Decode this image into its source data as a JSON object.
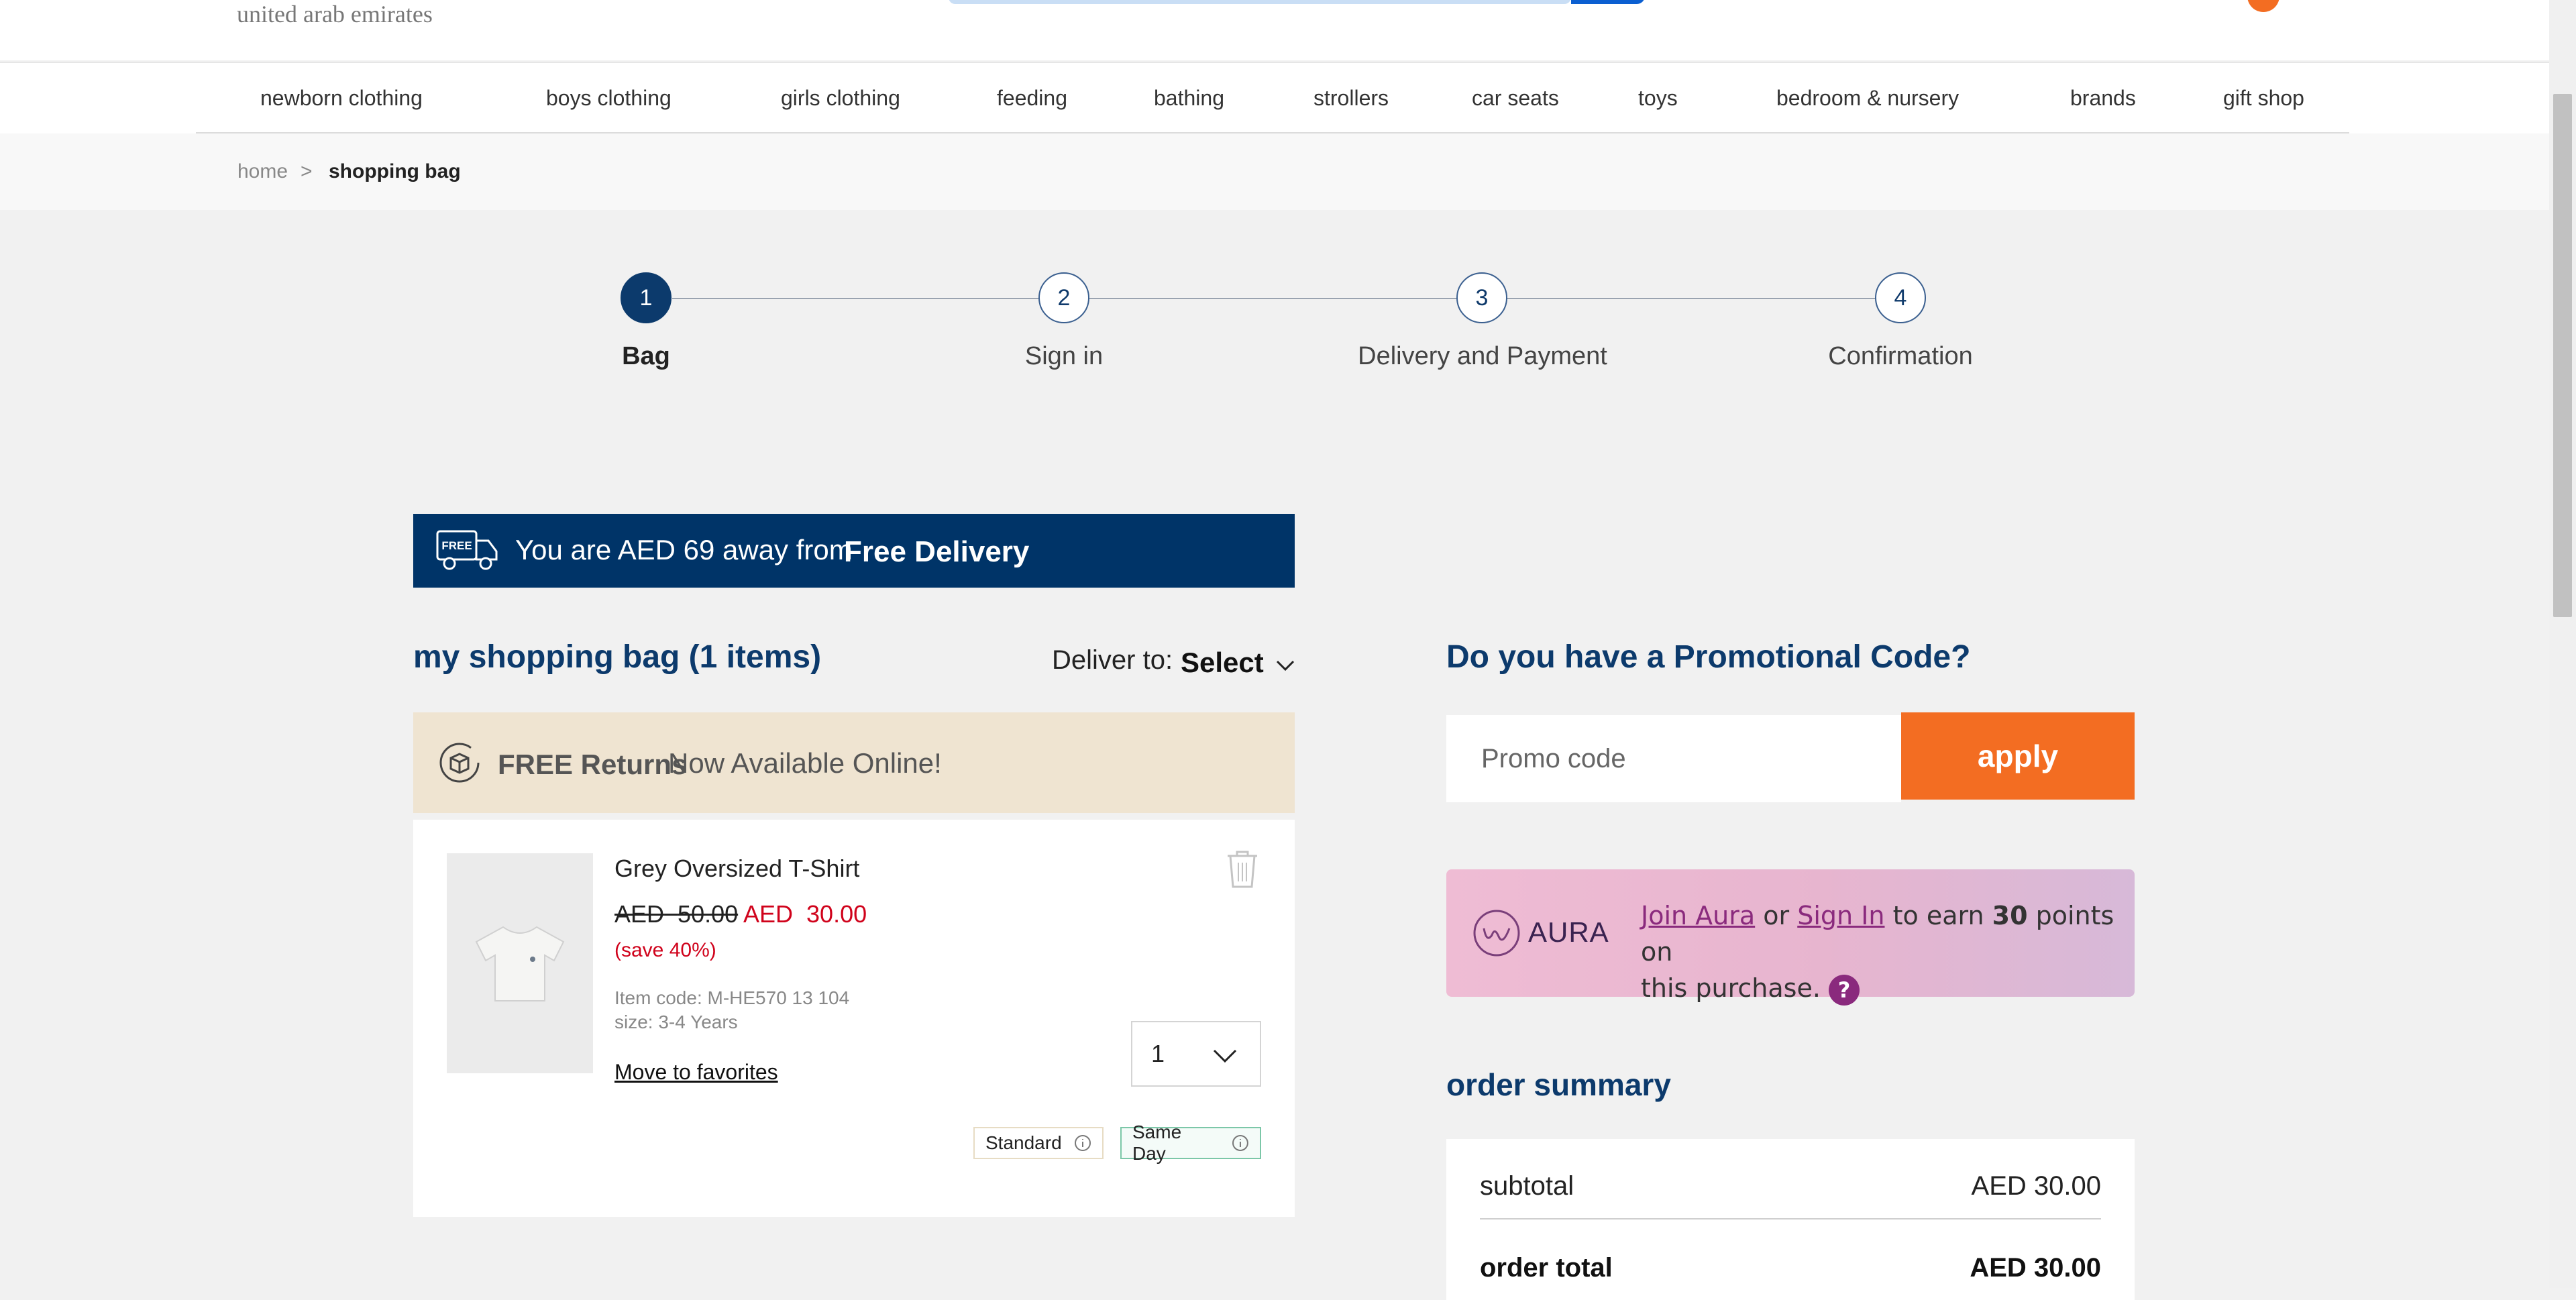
{
  "header": {
    "location": "united arab emirates"
  },
  "nav": {
    "items": [
      "newborn clothing",
      "boys clothing",
      "girls clothing",
      "feeding",
      "bathing",
      "strollers",
      "car seats",
      "toys",
      "bedroom & nursery",
      "brands",
      "gift shop"
    ]
  },
  "breadcrumb": {
    "home": "home",
    "separator": ">",
    "current": "shopping bag"
  },
  "stepper": {
    "steps": [
      {
        "number": "1",
        "label": "Bag"
      },
      {
        "number": "2",
        "label": "Sign in"
      },
      {
        "number": "3",
        "label": "Delivery and Payment"
      },
      {
        "number": "4",
        "label": "Confirmation"
      }
    ],
    "active_step": 1
  },
  "free_delivery": {
    "icon_text": "FREE",
    "prefix": "You are AED 69 away from",
    "highlight": "Free Delivery"
  },
  "bag": {
    "title": "my shopping bag (1 items)",
    "deliver_to_label": "Deliver to:",
    "deliver_to_value": "Select"
  },
  "returns": {
    "bold": "FREE Returns",
    "text": "Now Available Online!"
  },
  "item": {
    "name": "Grey Oversized T-Shirt",
    "old_currency": "AED",
    "old_price": "50.00",
    "new_price": "AED  30.00",
    "save": "(save 40%)",
    "item_code": "Item code: M-HE570 13 104",
    "size": "size: 3-4 Years",
    "move_to_favorites": "Move to favorites",
    "quantity": "1",
    "delivery_options": [
      "Standard",
      "Same Day"
    ]
  },
  "promo": {
    "title": "Do you have a Promotional Code?",
    "placeholder": "Promo code",
    "apply": "apply"
  },
  "aura": {
    "brand": "AURA",
    "join": "Join Aura",
    "or": "or",
    "sign_in": "Sign In",
    "earn_prefix": "to earn",
    "points": "30",
    "earn_suffix": "points on",
    "line2": "this purchase.",
    "help": "?"
  },
  "summary": {
    "title": "order summary",
    "subtotal_label": "subtotal",
    "subtotal_value": "AED 30.00",
    "total_label": "order total",
    "total_value": "AED 30.00"
  },
  "colors": {
    "primary_navy": "#003468",
    "accent_orange": "#f36d22",
    "sale_red": "#d0021b",
    "aura_purple": "#8a2a7d"
  }
}
